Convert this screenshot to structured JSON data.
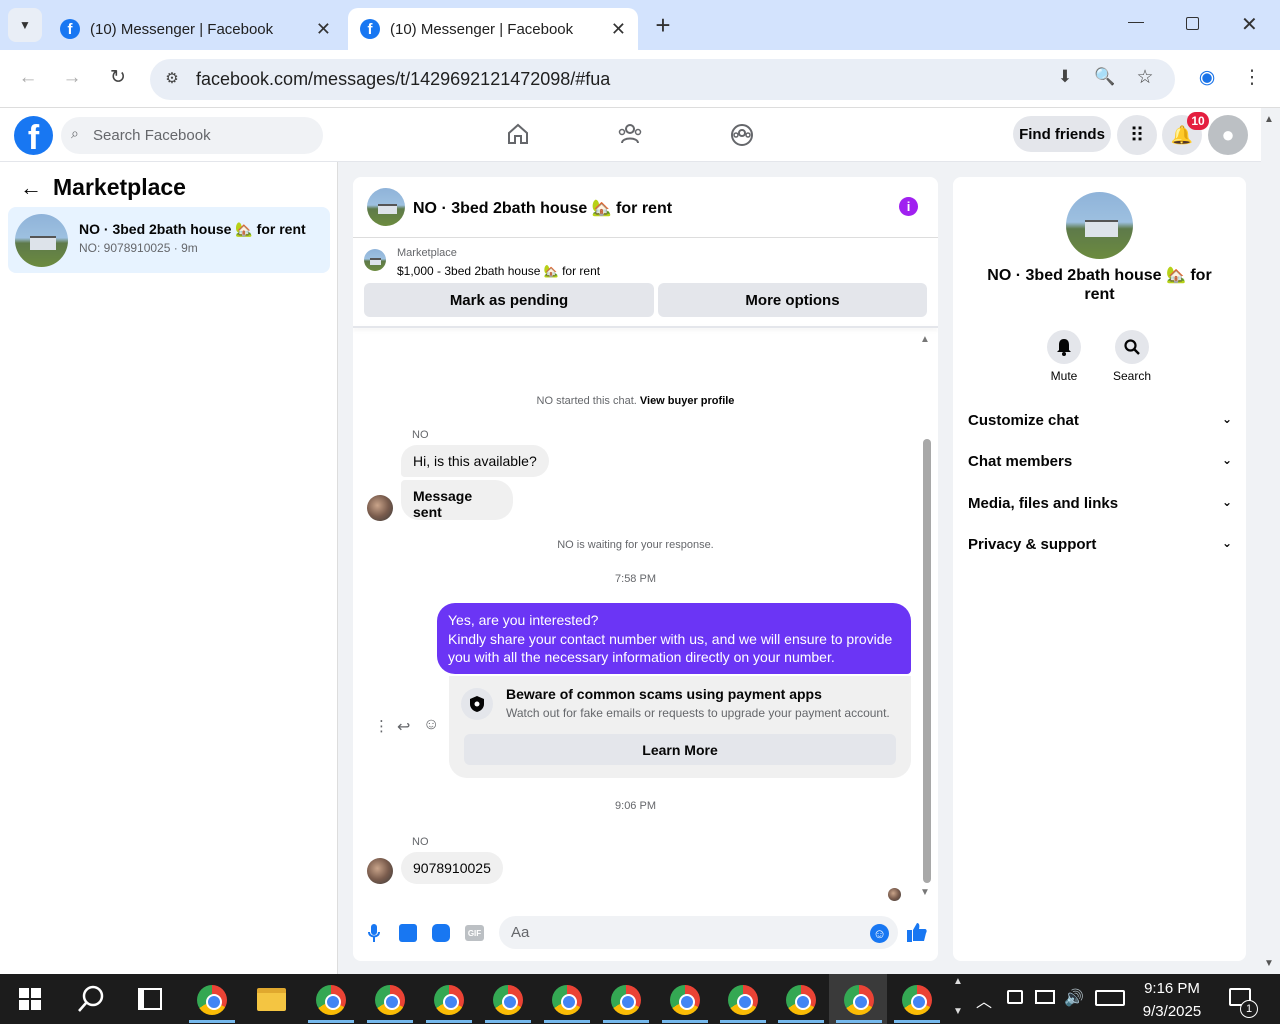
{
  "browser": {
    "tabs": [
      {
        "title": "(10) Messenger | Facebook"
      },
      {
        "title": "(10) Messenger | Facebook"
      }
    ],
    "new_tab": "+",
    "url": "facebook.com/messages/t/1429692121472098/#fua"
  },
  "fb_header": {
    "search_placeholder": "Search Facebook",
    "find_friends": "Find friends",
    "notification_count": "10"
  },
  "left_panel": {
    "title": "Marketplace",
    "conversation": {
      "title": "NO · 3bed 2bath house 🏡 for rent",
      "subtitle": "NO: 9078910025 · 9m"
    }
  },
  "chat": {
    "header_title": "NO · 3bed 2bath house 🏡 for rent",
    "listing_label": "Marketplace",
    "listing_title": "$1,000 - 3bed 2bath house 🏡 for rent",
    "mark_pending": "Mark as pending",
    "more_options": "More options",
    "started_text": "NO started this chat.",
    "view_buyer": "View buyer profile",
    "sender_name": "NO",
    "msg1": "Hi, is this available?",
    "msg2": "Message sent",
    "waiting": "NO is waiting for your response.",
    "time1": "7:58 PM",
    "out_line1": "Yes, are you interested?",
    "out_line2": "Kindly share your contact number with us, and we will ensure to provide you with all the necessary information directly on your number.",
    "warn_title": "Beware of common scams using payment apps",
    "warn_body": "Watch out for fake emails or requests to upgrade your payment account.",
    "learn_more": "Learn More",
    "time2": "9:06 PM",
    "msg3": "9078910025",
    "composer_placeholder": "Aa"
  },
  "right_panel": {
    "title": "NO · 3bed 2bath house 🏡 for rent",
    "mute": "Mute",
    "search": "Search",
    "sections": [
      "Customize chat",
      "Chat members",
      "Media, files and links",
      "Privacy & support"
    ]
  },
  "taskbar": {
    "time": "9:16 PM",
    "date": "9/3/2025",
    "notif": "1"
  },
  "colors": {
    "fb_blue": "#1877f2",
    "messenger_purple": "#6b35f5",
    "tab_bar": "#d3e3fd"
  }
}
